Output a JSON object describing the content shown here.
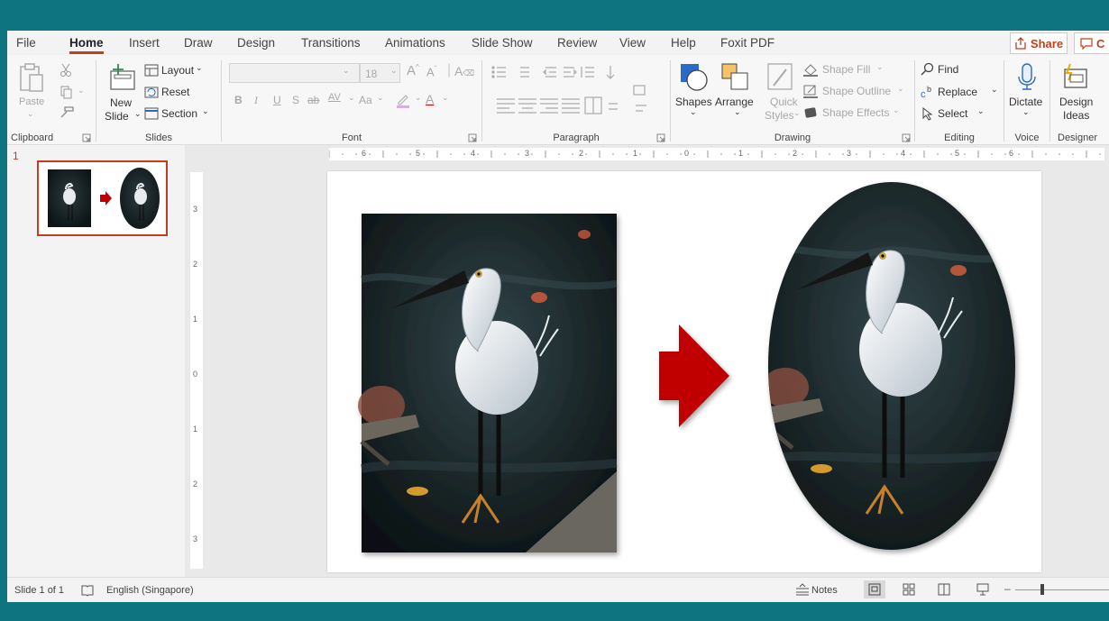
{
  "tabs": [
    "File",
    "Home",
    "Insert",
    "Draw",
    "Design",
    "Transitions",
    "Animations",
    "Slide Show",
    "Review",
    "View",
    "Help",
    "Foxit PDF"
  ],
  "active_tab": "Home",
  "share_label": "Share",
  "comments_label": "C",
  "ribbon": {
    "clipboard": {
      "paste": "Paste",
      "label": "Clipboard"
    },
    "slides": {
      "new_slide_1": "New",
      "new_slide_2": "Slide",
      "layout": "Layout",
      "reset": "Reset",
      "section": "Section",
      "label": "Slides"
    },
    "font": {
      "font_name": "",
      "font_size": "18",
      "bold": "B",
      "italic": "I",
      "underline": "U",
      "strike": "S",
      "strike2": "ab",
      "spacing": "AV",
      "case": "Aa",
      "label": "Font"
    },
    "paragraph": {
      "label": "Paragraph"
    },
    "drawing": {
      "shapes": "Shapes",
      "arrange": "Arrange",
      "quick_styles_1": "Quick",
      "quick_styles_2": "Styles",
      "shape_fill": "Shape Fill",
      "shape_outline": "Shape Outline",
      "shape_effects": "Shape Effects",
      "label": "Drawing"
    },
    "editing": {
      "find": "Find",
      "replace": "Replace",
      "select": "Select",
      "label": "Editing"
    },
    "voice": {
      "dictate": "Dictate",
      "label": "Voice"
    },
    "designer": {
      "design_ideas_1": "Design",
      "design_ideas_2": "Ideas",
      "label": "Designer"
    }
  },
  "slide_number": "1",
  "h_ruler": [
    "6",
    "5",
    "4",
    "3",
    "2",
    "1",
    "0",
    "1",
    "2",
    "3",
    "4",
    "5",
    "6"
  ],
  "v_ruler": [
    "3",
    "2",
    "1",
    "0",
    "1",
    "2",
    "3"
  ],
  "status": {
    "slide_info": "Slide 1 of 1",
    "language": "English (Singapore)",
    "notes": "Notes"
  },
  "colors": {
    "accent": "#c43e1c",
    "title_bar": "#0e7580",
    "arrow": "#c00000"
  }
}
